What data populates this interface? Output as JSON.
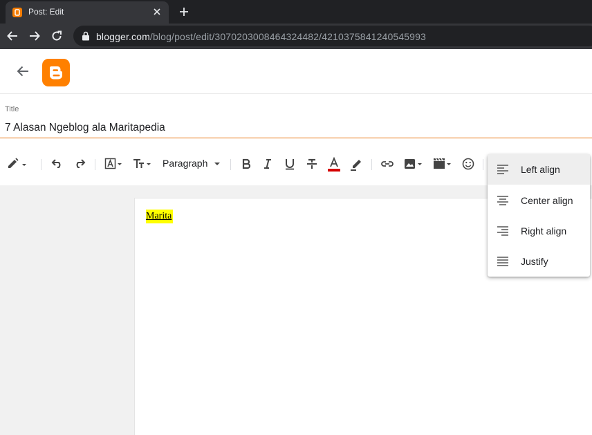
{
  "browser": {
    "tab_title": "Post: Edit",
    "url_host": "blogger.com",
    "url_path": "/blog/post/edit/3070203008464324482/4210375841240545993"
  },
  "post": {
    "title_label": "Title",
    "title_value": "7 Alasan Ngeblog ala Maritapedia",
    "body_text": "Marita"
  },
  "toolbar": {
    "paragraph_label": "Paragraph"
  },
  "align_menu": {
    "items": [
      {
        "label": "Left align",
        "icon": "align-left-icon",
        "active": true
      },
      {
        "label": "Center align",
        "icon": "align-center-icon",
        "active": false
      },
      {
        "label": "Right align",
        "icon": "align-right-icon",
        "active": false
      },
      {
        "label": "Justify",
        "icon": "align-justify-icon",
        "active": false
      }
    ]
  },
  "colors": {
    "accent": "#e8710a",
    "brand": "#ff8000",
    "text_color_swatch": "#d50000",
    "highlight": "#ffff00"
  }
}
